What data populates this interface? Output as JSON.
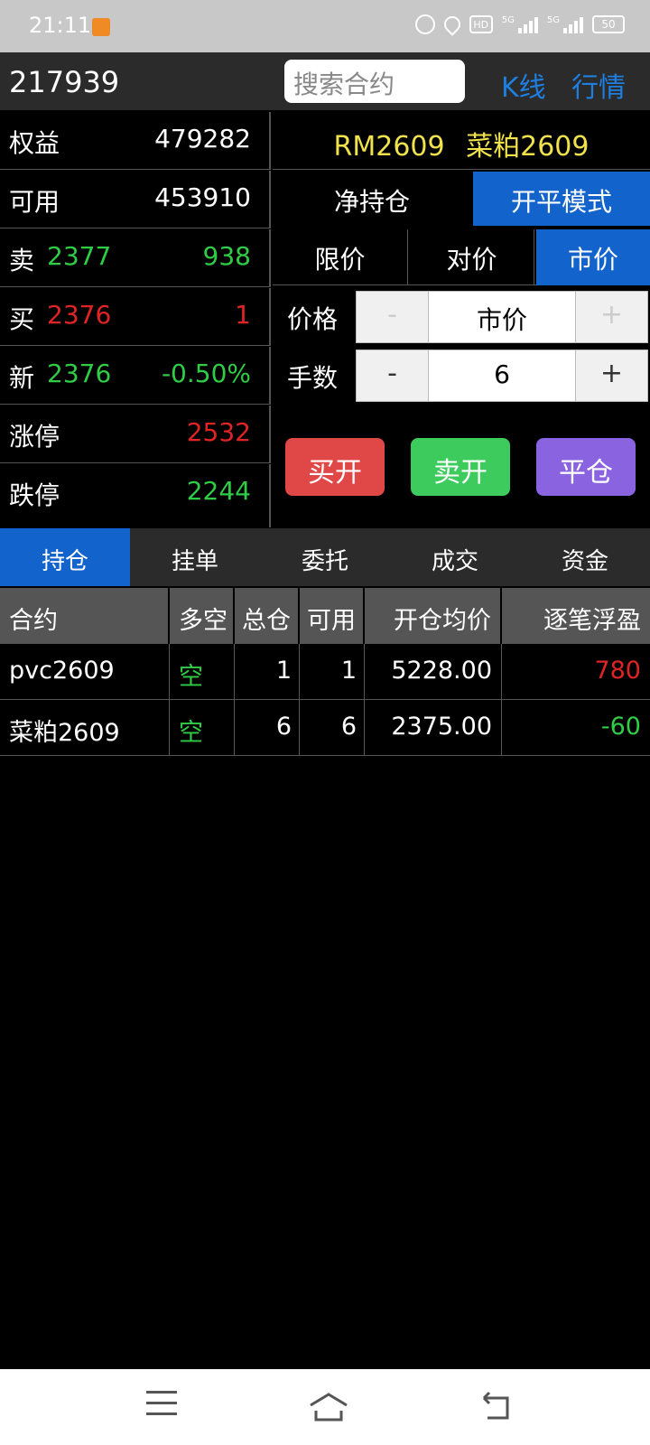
{
  "status_bar": {
    "time": "21:11",
    "icons": [
      "alarm-icon",
      "location-icon",
      "hd-icon",
      "signal-5g-icon",
      "signal-5g-icon",
      "battery-icon"
    ],
    "battery": "50",
    "hd_label": "HD",
    "net1": "5G",
    "net2": "5G"
  },
  "header": {
    "account": "217939",
    "search_placeholder": "搜索合约",
    "kline_label": "K线",
    "quote_label": "行情"
  },
  "info": {
    "equity_label": "权益",
    "equity_value": "479282",
    "available_label": "可用",
    "available_value": "453910",
    "ask_label": "卖",
    "ask_price": "2377",
    "ask_volume": "938",
    "bid_label": "买",
    "bid_price": "2376",
    "bid_volume": "1",
    "last_label": "新",
    "last_price": "2376",
    "last_change": "-0.50%",
    "limit_up_label": "涨停",
    "limit_up_value": "2532",
    "limit_down_label": "跌停",
    "limit_down_value": "2244"
  },
  "contract": {
    "code": "RM2609",
    "name": "菜粕2609"
  },
  "modes": {
    "net_position": "净持仓",
    "open_close_mode": "开平模式"
  },
  "price_types": {
    "limit": "限价",
    "opponent": "对价",
    "market": "市价"
  },
  "order": {
    "price_label": "价格",
    "price_value": "市价",
    "qty_label": "手数",
    "qty_value": "6",
    "minus": "-",
    "plus": "+"
  },
  "actions": {
    "buy_open": "买开",
    "sell_open": "卖开",
    "close": "平仓"
  },
  "colors": {
    "accent_blue": "#1363cc",
    "up_red": "#e02424",
    "down_green": "#2fcc45",
    "contract_yellow": "#f0e24a"
  },
  "tabs": [
    {
      "label": "持仓",
      "active": true
    },
    {
      "label": "挂单",
      "active": false
    },
    {
      "label": "委托",
      "active": false
    },
    {
      "label": "成交",
      "active": false
    },
    {
      "label": "资金",
      "active": false
    }
  ],
  "positions": {
    "headers": [
      "合约",
      "多空",
      "总仓",
      "可用",
      "开仓均价",
      "逐笔浮盈"
    ],
    "rows": [
      {
        "contract": "pvc2609",
        "direction": "空",
        "total": "1",
        "available": "1",
        "avg_price": "5228.00",
        "pnl": "780"
      },
      {
        "contract": "菜粕2609",
        "direction": "空",
        "total": "6",
        "available": "6",
        "avg_price": "2375.00",
        "pnl": "-60"
      }
    ]
  },
  "navbar": {
    "icons": [
      "menu-icon",
      "home-icon",
      "back-icon"
    ]
  }
}
